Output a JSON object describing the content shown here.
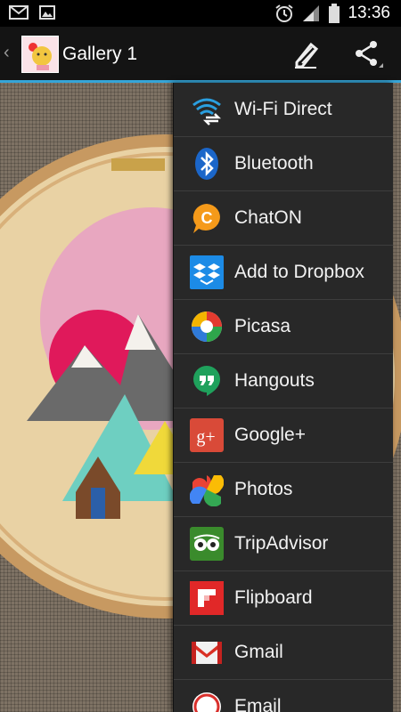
{
  "status_bar": {
    "time": "13:36"
  },
  "action_bar": {
    "back_glyph": "‹",
    "title": "Gallery 1"
  },
  "share_menu": {
    "items": [
      {
        "label": "Wi-Fi Direct",
        "icon": "wifi-direct-icon"
      },
      {
        "label": "Bluetooth",
        "icon": "bluetooth-icon"
      },
      {
        "label": "ChatON",
        "icon": "chaton-icon"
      },
      {
        "label": "Add to Dropbox",
        "icon": "dropbox-icon"
      },
      {
        "label": "Picasa",
        "icon": "picasa-icon"
      },
      {
        "label": "Hangouts",
        "icon": "hangouts-icon"
      },
      {
        "label": "Google+",
        "icon": "google-plus-icon"
      },
      {
        "label": "Photos",
        "icon": "photos-icon"
      },
      {
        "label": "TripAdvisor",
        "icon": "tripadvisor-icon"
      },
      {
        "label": "Flipboard",
        "icon": "flipboard-icon"
      },
      {
        "label": "Gmail",
        "icon": "gmail-icon"
      },
      {
        "label": "Email",
        "icon": "email-icon"
      }
    ]
  },
  "colors": {
    "accent": "#36a5d8",
    "menu_bg": "#282828"
  }
}
